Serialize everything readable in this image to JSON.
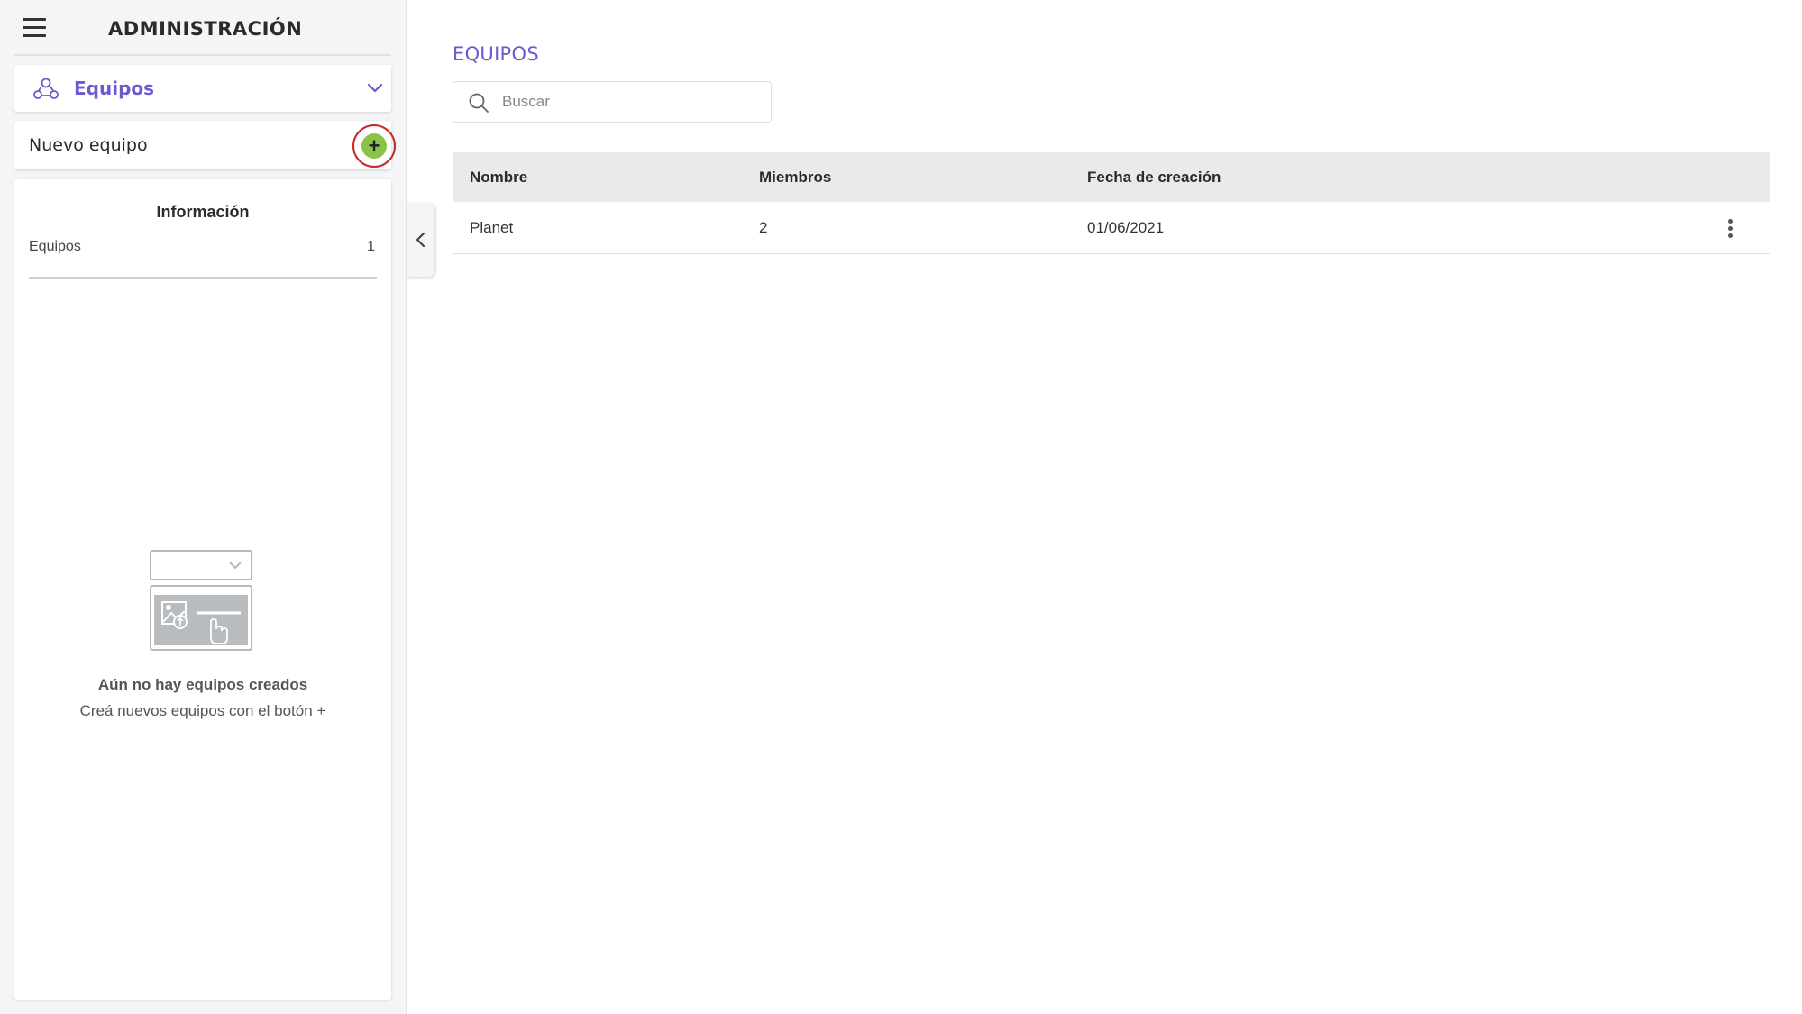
{
  "sidebar": {
    "title": "ADMINISTRACIÓN",
    "section": {
      "label": "Equipos",
      "icon": "team-icon"
    },
    "new_item": {
      "label": "Nuevo equipo",
      "add_symbol": "+"
    },
    "info": {
      "title": "Información",
      "rows": [
        {
          "label": "Equipos",
          "value": "1"
        }
      ]
    },
    "empty_state": {
      "title": "Aún no hay equipos creados",
      "subtitle": "Creá nuevos equipos con el botón +"
    }
  },
  "main": {
    "title": "EQUIPOS",
    "search": {
      "placeholder": "Buscar",
      "value": ""
    },
    "table": {
      "columns": [
        "Nombre",
        "Miembros",
        "Fecha de creación"
      ],
      "rows": [
        {
          "name": "Planet",
          "members": "2",
          "created": "01/06/2021"
        }
      ]
    }
  },
  "colors": {
    "accent": "#6a5acd",
    "add_button": "#8bc34a",
    "highlight_ring": "#c62828",
    "sidebar_bg": "#f4f5f6",
    "table_header_bg": "#e8eaeb"
  }
}
